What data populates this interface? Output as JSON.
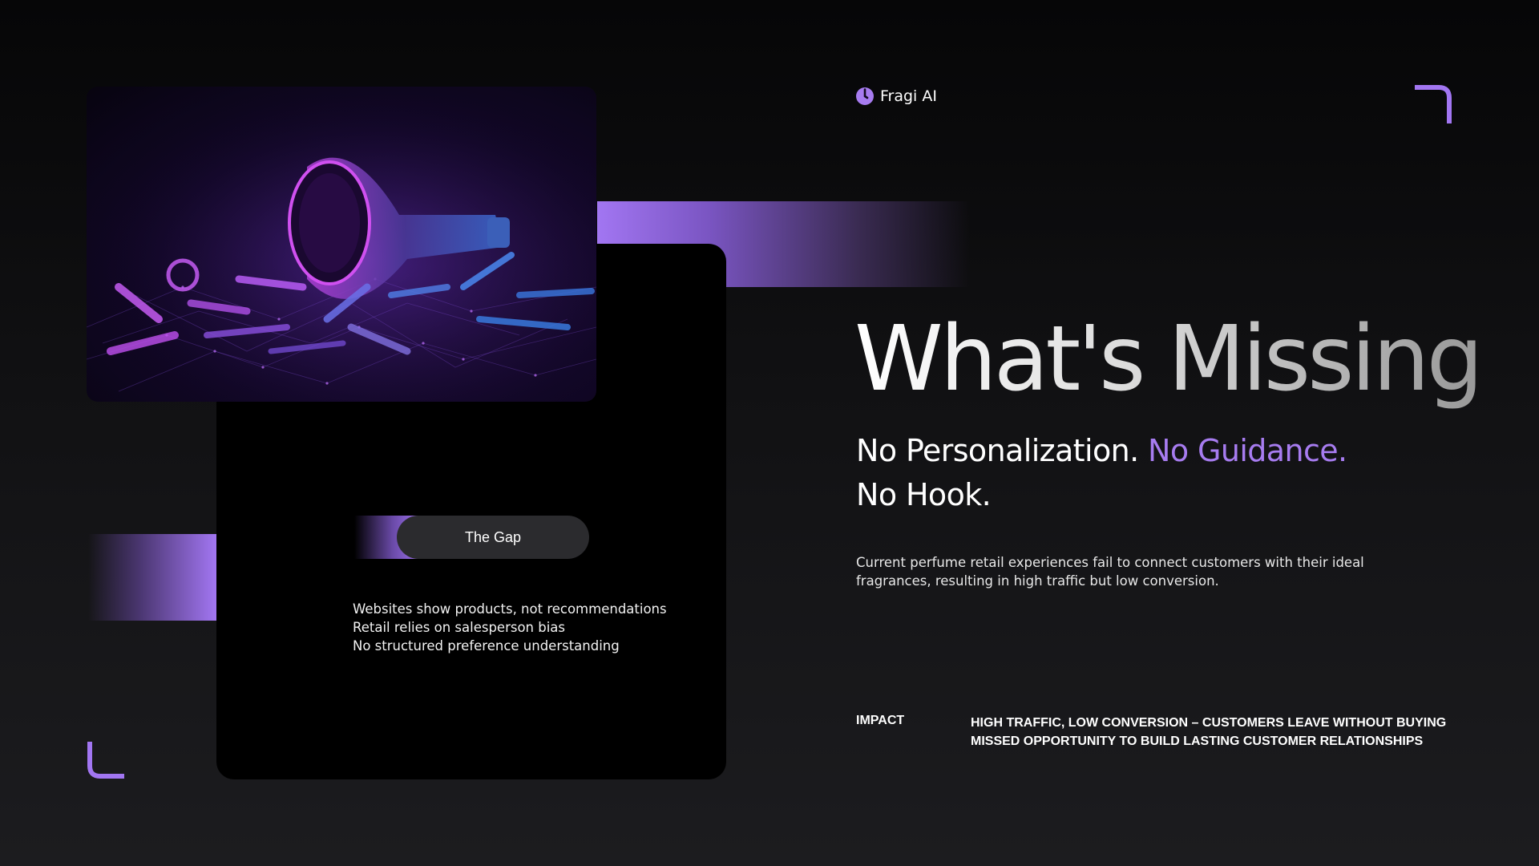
{
  "brand": {
    "name": "Fragi AI",
    "icon": "brand-logo-icon",
    "accent_color": "#a77cf0"
  },
  "headline": "What's Missing",
  "subhead": {
    "part1": "No Personalization.",
    "part2": "No Guidance.",
    "part3": "No Hook."
  },
  "description": "Current perfume retail experiences fail to connect customers with their ideal fragrances, resulting in high traffic but low conversion.",
  "gap_card": {
    "pill_label": "The Gap",
    "items": [
      "Websites show products, not recommendations",
      "Retail relies on salesperson bias",
      "No structured preference understanding"
    ]
  },
  "impact": {
    "label": "IMPACT",
    "items": [
      "HIGH TRAFFIC, LOW CONVERSION – CUSTOMERS LEAVE WITHOUT BUYING",
      "MISSED OPPORTUNITY TO BUILD LASTING CUSTOMER RELATIONSHIPS"
    ]
  },
  "colors": {
    "background": "#101012",
    "card": "#000000",
    "pill": "#2b2b2e",
    "accent": "#a276f2"
  }
}
